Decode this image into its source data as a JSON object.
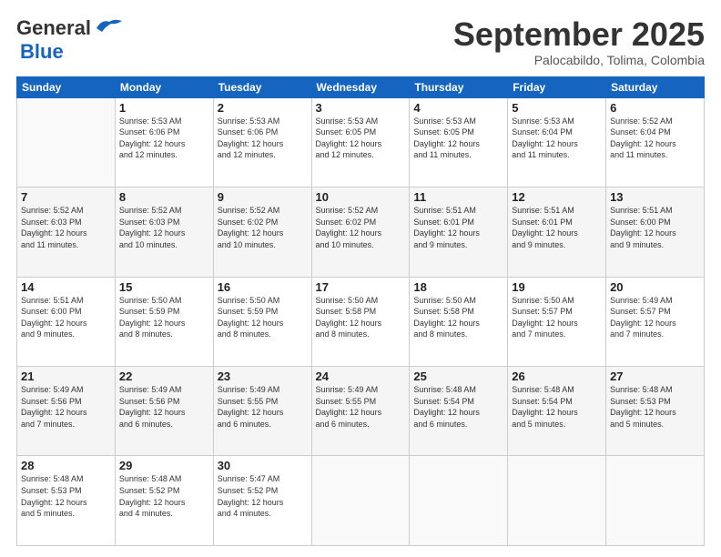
{
  "header": {
    "logo_general": "General",
    "logo_blue": "Blue",
    "month_title": "September 2025",
    "subtitle": "Palocabildo, Tolima, Colombia"
  },
  "weekdays": [
    "Sunday",
    "Monday",
    "Tuesday",
    "Wednesday",
    "Thursday",
    "Friday",
    "Saturday"
  ],
  "weeks": [
    [
      {
        "day": "",
        "info": ""
      },
      {
        "day": "1",
        "info": "Sunrise: 5:53 AM\nSunset: 6:06 PM\nDaylight: 12 hours\nand 12 minutes."
      },
      {
        "day": "2",
        "info": "Sunrise: 5:53 AM\nSunset: 6:06 PM\nDaylight: 12 hours\nand 12 minutes."
      },
      {
        "day": "3",
        "info": "Sunrise: 5:53 AM\nSunset: 6:05 PM\nDaylight: 12 hours\nand 12 minutes."
      },
      {
        "day": "4",
        "info": "Sunrise: 5:53 AM\nSunset: 6:05 PM\nDaylight: 12 hours\nand 11 minutes."
      },
      {
        "day": "5",
        "info": "Sunrise: 5:53 AM\nSunset: 6:04 PM\nDaylight: 12 hours\nand 11 minutes."
      },
      {
        "day": "6",
        "info": "Sunrise: 5:52 AM\nSunset: 6:04 PM\nDaylight: 12 hours\nand 11 minutes."
      }
    ],
    [
      {
        "day": "7",
        "info": "Sunrise: 5:52 AM\nSunset: 6:03 PM\nDaylight: 12 hours\nand 11 minutes."
      },
      {
        "day": "8",
        "info": "Sunrise: 5:52 AM\nSunset: 6:03 PM\nDaylight: 12 hours\nand 10 minutes."
      },
      {
        "day": "9",
        "info": "Sunrise: 5:52 AM\nSunset: 6:02 PM\nDaylight: 12 hours\nand 10 minutes."
      },
      {
        "day": "10",
        "info": "Sunrise: 5:52 AM\nSunset: 6:02 PM\nDaylight: 12 hours\nand 10 minutes."
      },
      {
        "day": "11",
        "info": "Sunrise: 5:51 AM\nSunset: 6:01 PM\nDaylight: 12 hours\nand 9 minutes."
      },
      {
        "day": "12",
        "info": "Sunrise: 5:51 AM\nSunset: 6:01 PM\nDaylight: 12 hours\nand 9 minutes."
      },
      {
        "day": "13",
        "info": "Sunrise: 5:51 AM\nSunset: 6:00 PM\nDaylight: 12 hours\nand 9 minutes."
      }
    ],
    [
      {
        "day": "14",
        "info": "Sunrise: 5:51 AM\nSunset: 6:00 PM\nDaylight: 12 hours\nand 9 minutes."
      },
      {
        "day": "15",
        "info": "Sunrise: 5:50 AM\nSunset: 5:59 PM\nDaylight: 12 hours\nand 8 minutes."
      },
      {
        "day": "16",
        "info": "Sunrise: 5:50 AM\nSunset: 5:59 PM\nDaylight: 12 hours\nand 8 minutes."
      },
      {
        "day": "17",
        "info": "Sunrise: 5:50 AM\nSunset: 5:58 PM\nDaylight: 12 hours\nand 8 minutes."
      },
      {
        "day": "18",
        "info": "Sunrise: 5:50 AM\nSunset: 5:58 PM\nDaylight: 12 hours\nand 8 minutes."
      },
      {
        "day": "19",
        "info": "Sunrise: 5:50 AM\nSunset: 5:57 PM\nDaylight: 12 hours\nand 7 minutes."
      },
      {
        "day": "20",
        "info": "Sunrise: 5:49 AM\nSunset: 5:57 PM\nDaylight: 12 hours\nand 7 minutes."
      }
    ],
    [
      {
        "day": "21",
        "info": "Sunrise: 5:49 AM\nSunset: 5:56 PM\nDaylight: 12 hours\nand 7 minutes."
      },
      {
        "day": "22",
        "info": "Sunrise: 5:49 AM\nSunset: 5:56 PM\nDaylight: 12 hours\nand 6 minutes."
      },
      {
        "day": "23",
        "info": "Sunrise: 5:49 AM\nSunset: 5:55 PM\nDaylight: 12 hours\nand 6 minutes."
      },
      {
        "day": "24",
        "info": "Sunrise: 5:49 AM\nSunset: 5:55 PM\nDaylight: 12 hours\nand 6 minutes."
      },
      {
        "day": "25",
        "info": "Sunrise: 5:48 AM\nSunset: 5:54 PM\nDaylight: 12 hours\nand 6 minutes."
      },
      {
        "day": "26",
        "info": "Sunrise: 5:48 AM\nSunset: 5:54 PM\nDaylight: 12 hours\nand 5 minutes."
      },
      {
        "day": "27",
        "info": "Sunrise: 5:48 AM\nSunset: 5:53 PM\nDaylight: 12 hours\nand 5 minutes."
      }
    ],
    [
      {
        "day": "28",
        "info": "Sunrise: 5:48 AM\nSunset: 5:53 PM\nDaylight: 12 hours\nand 5 minutes."
      },
      {
        "day": "29",
        "info": "Sunrise: 5:48 AM\nSunset: 5:52 PM\nDaylight: 12 hours\nand 4 minutes."
      },
      {
        "day": "30",
        "info": "Sunrise: 5:47 AM\nSunset: 5:52 PM\nDaylight: 12 hours\nand 4 minutes."
      },
      {
        "day": "",
        "info": ""
      },
      {
        "day": "",
        "info": ""
      },
      {
        "day": "",
        "info": ""
      },
      {
        "day": "",
        "info": ""
      }
    ]
  ]
}
